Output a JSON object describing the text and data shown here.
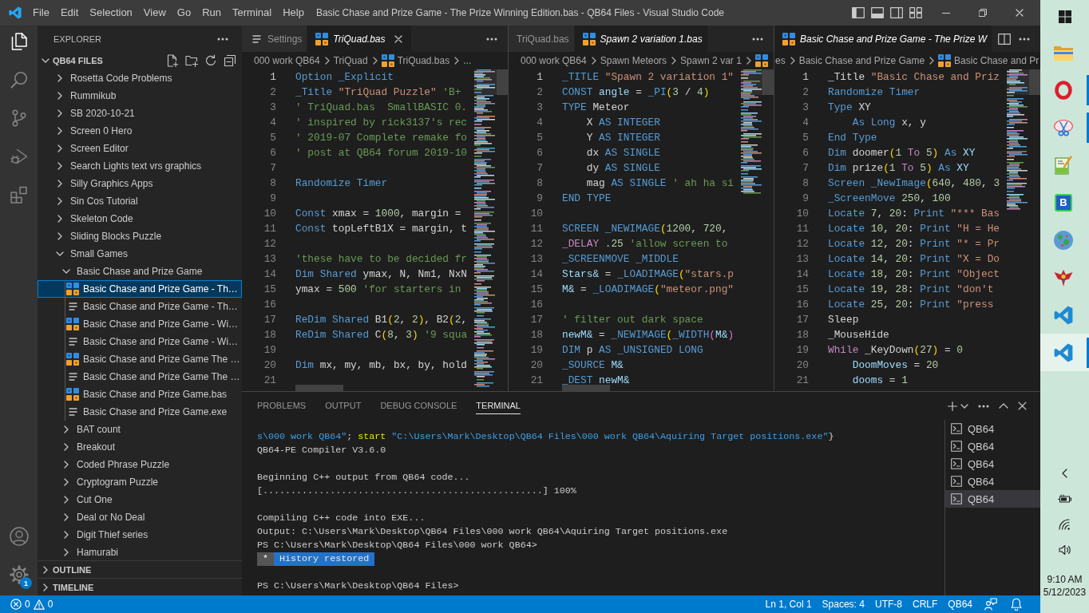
{
  "title_bar": {
    "menu": [
      "File",
      "Edit",
      "Selection",
      "View",
      "Go",
      "Run",
      "Terminal",
      "Help"
    ],
    "title": "Basic Chase and Prize Game - The Prize Winning Edition.bas - QB64 Files - Visual Studio Code"
  },
  "activity_bar": {
    "items": [
      {
        "kind": "explorer",
        "selected": true
      },
      {
        "kind": "search",
        "selected": false
      },
      {
        "kind": "source_control",
        "selected": false
      },
      {
        "kind": "run_debug",
        "selected": false
      },
      {
        "kind": "extensions",
        "selected": false
      }
    ],
    "bottom_items": [
      {
        "kind": "accounts"
      },
      {
        "kind": "manage",
        "badge": "1"
      }
    ]
  },
  "sidebar": {
    "title": "EXPLORER",
    "section": {
      "title": "QB64 FILES",
      "expanded": true
    },
    "tree": [
      {
        "label": "Rosetta Code Problems",
        "kind": "folder",
        "expanded": false,
        "selected": false
      },
      {
        "label": "Rummikub",
        "kind": "folder",
        "expanded": false,
        "selected": false
      },
      {
        "label": "SB 2020-10-21",
        "kind": "folder",
        "expanded": false,
        "selected": false
      },
      {
        "label": "Screen 0 Hero",
        "kind": "folder",
        "expanded": false,
        "selected": false
      },
      {
        "label": "Screen Editor",
        "kind": "folder",
        "expanded": false,
        "selected": false
      },
      {
        "label": "Search Lights text vrs graphics",
        "kind": "folder",
        "expanded": false,
        "selected": false
      },
      {
        "label": "Silly Graphics Apps",
        "kind": "folder",
        "expanded": false,
        "selected": false
      },
      {
        "label": "Sin Cos Tutorial",
        "kind": "folder",
        "expanded": false,
        "selected": false
      },
      {
        "label": "Skeleton Code",
        "kind": "folder",
        "expanded": false,
        "selected": false
      },
      {
        "label": "Sliding Blocks Puzzle",
        "kind": "folder",
        "expanded": false,
        "selected": false
      },
      {
        "label": "Small Games",
        "kind": "folder",
        "expanded": true,
        "selected": false,
        "children": [
          {
            "label": "Basic Chase and Prize Game",
            "kind": "folder",
            "expanded": true,
            "selected": false,
            "children": [
              {
                "label": "Basic Chase and Prize Game - Th…",
                "kind": "qb64_file",
                "selected": true
              },
              {
                "label": "Basic Chase and Prize Game - Th…",
                "kind": "plain_file",
                "selected": false
              },
              {
                "label": "Basic Chase and Prize Game - Wi…",
                "kind": "qb64_file",
                "selected": false
              },
              {
                "label": "Basic Chase and Prize Game - Wi…",
                "kind": "plain_file",
                "selected": false
              },
              {
                "label": "Basic Chase and Prize Game The …",
                "kind": "qb64_file",
                "selected": false
              },
              {
                "label": "Basic Chase and Prize Game The …",
                "kind": "plain_file",
                "selected": false
              },
              {
                "label": "Basic Chase and Prize Game.bas",
                "kind": "qb64_file",
                "selected": false
              },
              {
                "label": "Basic Chase and Prize Game.exe",
                "kind": "plain_file",
                "selected": false
              }
            ]
          },
          {
            "label": "BAT count",
            "kind": "folder",
            "expanded": false,
            "selected": false
          },
          {
            "label": "Breakout",
            "kind": "folder",
            "expanded": false,
            "selected": false
          },
          {
            "label": "Coded Phrase Puzzle",
            "kind": "folder",
            "expanded": false,
            "selected": false
          },
          {
            "label": "Cryptogram Puzzle",
            "kind": "folder",
            "expanded": false,
            "selected": false
          },
          {
            "label": "Cut One",
            "kind": "folder",
            "expanded": false,
            "selected": false
          },
          {
            "label": "Deal or No Deal",
            "kind": "folder",
            "expanded": false,
            "selected": false
          },
          {
            "label": "Digit Thief series",
            "kind": "folder",
            "expanded": false,
            "selected": false
          },
          {
            "label": "Hamurabi",
            "kind": "folder",
            "expanded": false,
            "selected": false
          }
        ]
      }
    ],
    "bottom_sections": [
      {
        "title": "OUTLINE",
        "expanded": false
      },
      {
        "title": "TIMELINE",
        "expanded": false
      }
    ]
  },
  "editor_groups": [
    {
      "tabs": [
        {
          "label": "Settings",
          "kind": "settings_file",
          "selected": false,
          "preview": false,
          "close_visible": false
        },
        {
          "label": "TriQuad.bas",
          "kind": "qb64_file",
          "selected": true,
          "preview": true,
          "close_visible": true
        }
      ],
      "split_button": false,
      "breadcrumbs": {
        "scrolled": false,
        "items": [
          {
            "label": "000 work QB64",
            "kind": "folder"
          },
          {
            "label": "TriQuad",
            "kind": "folder"
          },
          {
            "label": "TriQuad.bas",
            "kind": "file"
          },
          {
            "label": "...",
            "kind": "symbols"
          }
        ]
      },
      "horizontal_scrollbar": true,
      "lines": [
        {
          "number": "1",
          "current": true,
          "tokens": [
            {
              "kind": "keyword",
              "text": "Option _Explicit"
            }
          ]
        },
        {
          "number": "2",
          "current": false,
          "tokens": [
            {
              "kind": "keyword",
              "text": "_Title"
            },
            {
              "kind": "string",
              "text": " \"TriQuad Puzzle\""
            },
            {
              "kind": "comment",
              "text": " 'B+"
            }
          ]
        },
        {
          "number": "3",
          "current": false,
          "tokens": [
            {
              "kind": "comment",
              "text": "' TriQuad.bas  SmallBASIC 0."
            }
          ]
        },
        {
          "number": "4",
          "current": false,
          "tokens": [
            {
              "kind": "comment",
              "text": "' inspired by rick3137's rec"
            }
          ]
        },
        {
          "number": "5",
          "current": false,
          "tokens": [
            {
              "kind": "comment",
              "text": "' 2019-07 Complete remake fo"
            }
          ]
        },
        {
          "number": "6",
          "current": false,
          "tokens": [
            {
              "kind": "comment",
              "text": "' post at QB64 forum 2019-10"
            }
          ]
        },
        {
          "number": "7",
          "current": false
        },
        {
          "number": "8",
          "current": false,
          "tokens": [
            {
              "kind": "keyword",
              "text": "Randomize Timer"
            }
          ]
        },
        {
          "number": "9",
          "current": false
        },
        {
          "number": "10",
          "current": false,
          "tokens": [
            {
              "kind": "keyword",
              "text": "Const"
            },
            {
              "kind": "plain",
              "text": " xmax = "
            },
            {
              "kind": "number",
              "text": "1000"
            },
            {
              "kind": "plain",
              "text": ", margin ="
            }
          ]
        },
        {
          "number": "11",
          "current": false,
          "tokens": [
            {
              "kind": "keyword",
              "text": "Const"
            },
            {
              "kind": "plain",
              "text": " topLeftB1X = margin, t"
            }
          ]
        },
        {
          "number": "12",
          "current": false
        },
        {
          "number": "13",
          "current": false,
          "tokens": [
            {
              "kind": "comment",
              "text": "'these have to be decided fr"
            }
          ]
        },
        {
          "number": "14",
          "current": false,
          "tokens": [
            {
              "kind": "keyword",
              "text": "Dim Shared"
            },
            {
              "kind": "plain",
              "text": " ymax, N, Nm1, NxN"
            }
          ]
        },
        {
          "number": "15",
          "current": false,
          "tokens": [
            {
              "kind": "plain",
              "text": "ymax = "
            },
            {
              "kind": "number",
              "text": "500"
            },
            {
              "kind": "comment",
              "text": " 'for starters in"
            }
          ]
        },
        {
          "number": "16",
          "current": false
        },
        {
          "number": "17",
          "current": false,
          "tokens": [
            {
              "kind": "keyword",
              "text": "ReDim Shared"
            },
            {
              "kind": "plain",
              "text": " B1"
            },
            {
              "kind": "bracket",
              "text": "("
            },
            {
              "kind": "number",
              "text": "2"
            },
            {
              "kind": "plain",
              "text": ", "
            },
            {
              "kind": "number",
              "text": "2"
            },
            {
              "kind": "bracket",
              "text": ")"
            },
            {
              "kind": "plain",
              "text": ", B2"
            },
            {
              "kind": "bracket",
              "text": "("
            },
            {
              "kind": "number",
              "text": "2"
            },
            {
              "kind": "plain",
              "text": ","
            }
          ]
        },
        {
          "number": "18",
          "current": false,
          "tokens": [
            {
              "kind": "keyword",
              "text": "ReDim Shared"
            },
            {
              "kind": "plain",
              "text": " C"
            },
            {
              "kind": "bracket",
              "text": "("
            },
            {
              "kind": "number",
              "text": "8"
            },
            {
              "kind": "plain",
              "text": ", "
            },
            {
              "kind": "number",
              "text": "3"
            },
            {
              "kind": "bracket",
              "text": ")"
            },
            {
              "kind": "comment",
              "text": " '9 squa"
            }
          ]
        },
        {
          "number": "19",
          "current": false
        },
        {
          "number": "20",
          "current": false,
          "tokens": [
            {
              "kind": "keyword",
              "text": "Dim"
            },
            {
              "kind": "plain",
              "text": " mx, my, mb, bx, by, hold"
            }
          ]
        },
        {
          "number": "21",
          "current": false
        }
      ]
    },
    {
      "tabs": [
        {
          "label": "TriQuad.bas",
          "kind": "text_only",
          "selected": false,
          "preview": false,
          "close_visible": false
        },
        {
          "label": "Spawn 2 variation 1.bas",
          "kind": "qb64_file",
          "selected": true,
          "preview": true,
          "close_visible": false
        }
      ],
      "split_button": false,
      "breadcrumbs": {
        "scrolled": false,
        "items": [
          {
            "label": "000 work QB64",
            "kind": "folder"
          },
          {
            "label": "Spawn Meteors",
            "kind": "folder"
          },
          {
            "label": "Spawn 2 var 1",
            "kind": "folder"
          },
          {
            "kind": "file"
          }
        ]
      },
      "horizontal_scrollbar": true,
      "lines": [
        {
          "number": "1",
          "current": true,
          "tokens": [
            {
              "kind": "keyword",
              "text": "_TITLE"
            },
            {
              "kind": "string",
              "text": " \"Spawn 2 variation 1\""
            }
          ]
        },
        {
          "number": "2",
          "current": false,
          "tokens": [
            {
              "kind": "keyword",
              "text": "CONST"
            },
            {
              "kind": "variable",
              "text": " angle"
            },
            {
              "kind": "plain",
              "text": " = "
            },
            {
              "kind": "keyword",
              "text": "_PI"
            },
            {
              "kind": "bracket",
              "text": "("
            },
            {
              "kind": "number",
              "text": "3"
            },
            {
              "kind": "plain",
              "text": " / "
            },
            {
              "kind": "number",
              "text": "4"
            },
            {
              "kind": "bracket",
              "text": ")"
            }
          ]
        },
        {
          "number": "3",
          "current": false,
          "tokens": [
            {
              "kind": "keyword",
              "text": "TYPE"
            },
            {
              "kind": "plain",
              "text": " Meteor"
            }
          ]
        },
        {
          "number": "4",
          "current": false,
          "tokens": [
            {
              "kind": "plain",
              "text": "    X "
            },
            {
              "kind": "keyword",
              "text": "AS INTEGER"
            }
          ]
        },
        {
          "number": "5",
          "current": false,
          "tokens": [
            {
              "kind": "plain",
              "text": "    Y "
            },
            {
              "kind": "keyword",
              "text": "AS INTEGER"
            }
          ]
        },
        {
          "number": "6",
          "current": false,
          "tokens": [
            {
              "kind": "plain",
              "text": "    dx "
            },
            {
              "kind": "keyword",
              "text": "AS SINGLE"
            }
          ]
        },
        {
          "number": "7",
          "current": false,
          "tokens": [
            {
              "kind": "plain",
              "text": "    dy "
            },
            {
              "kind": "keyword",
              "text": "AS SINGLE"
            }
          ]
        },
        {
          "number": "8",
          "current": false,
          "tokens": [
            {
              "kind": "plain",
              "text": "    mag "
            },
            {
              "kind": "keyword",
              "text": "AS SINGLE"
            },
            {
              "kind": "comment",
              "text": " ' ah ha si"
            }
          ]
        },
        {
          "number": "9",
          "current": false,
          "tokens": [
            {
              "kind": "keyword",
              "text": "END TYPE"
            }
          ]
        },
        {
          "number": "10",
          "current": false
        },
        {
          "number": "11",
          "current": false,
          "tokens": [
            {
              "kind": "keyword",
              "text": "SCREEN _NEWIMAGE"
            },
            {
              "kind": "bracket",
              "text": "("
            },
            {
              "kind": "number",
              "text": "1200"
            },
            {
              "kind": "plain",
              "text": ", "
            },
            {
              "kind": "number",
              "text": "720"
            },
            {
              "kind": "plain",
              "text": ","
            }
          ]
        },
        {
          "number": "12",
          "current": false,
          "tokens": [
            {
              "kind": "control",
              "text": "_DELAY"
            },
            {
              "kind": "number",
              "text": " .25"
            },
            {
              "kind": "comment",
              "text": " 'allow screen to"
            }
          ]
        },
        {
          "number": "13",
          "current": false,
          "tokens": [
            {
              "kind": "keyword",
              "text": "_SCREENMOVE _MIDDLE"
            }
          ]
        },
        {
          "number": "14",
          "current": false,
          "tokens": [
            {
              "kind": "variable",
              "text": "Stars&"
            },
            {
              "kind": "plain",
              "text": " = "
            },
            {
              "kind": "keyword",
              "text": "_LOADIMAGE"
            },
            {
              "kind": "bracket",
              "text": "("
            },
            {
              "kind": "string",
              "text": "\"stars.p"
            }
          ]
        },
        {
          "number": "15",
          "current": false,
          "tokens": [
            {
              "kind": "variable",
              "text": "M&"
            },
            {
              "kind": "plain",
              "text": " = "
            },
            {
              "kind": "keyword",
              "text": "_LOADIMAGE"
            },
            {
              "kind": "bracket",
              "text": "("
            },
            {
              "kind": "string",
              "text": "\"meteor.png\""
            }
          ]
        },
        {
          "number": "16",
          "current": false
        },
        {
          "number": "17",
          "current": false,
          "tokens": [
            {
              "kind": "comment",
              "text": "' filter out dark space"
            }
          ]
        },
        {
          "number": "18",
          "current": false,
          "tokens": [
            {
              "kind": "variable",
              "text": "newM&"
            },
            {
              "kind": "plain",
              "text": " = "
            },
            {
              "kind": "keyword",
              "text": "_NEWIMAGE"
            },
            {
              "kind": "bracket",
              "text": "("
            },
            {
              "kind": "keyword",
              "text": "_WIDTH"
            },
            {
              "kind": "bracket2",
              "text": "("
            },
            {
              "kind": "variable",
              "text": "M&"
            },
            {
              "kind": "bracket2",
              "text": ")"
            }
          ]
        },
        {
          "number": "19",
          "current": false,
          "tokens": [
            {
              "kind": "keyword",
              "text": "DIM"
            },
            {
              "kind": "plain",
              "text": " p "
            },
            {
              "kind": "keyword",
              "text": "AS _UNSIGNED LONG"
            }
          ]
        },
        {
          "number": "20",
          "current": false,
          "tokens": [
            {
              "kind": "keyword",
              "text": "_SOURCE"
            },
            {
              "kind": "variable",
              "text": " M&"
            }
          ]
        },
        {
          "number": "21",
          "current": false,
          "tokens": [
            {
              "kind": "keyword",
              "text": "_DEST"
            },
            {
              "kind": "variable",
              "text": " newM&"
            }
          ]
        }
      ]
    },
    {
      "tabs": [
        {
          "label": "Basic Chase and Prize Game - The Prize W",
          "kind": "qb64_file",
          "selected": true,
          "preview": true,
          "close_visible": false
        }
      ],
      "split_button": true,
      "breadcrumbs": {
        "scrolled": true,
        "items": [
          {
            "label": "es",
            "kind": "folder"
          },
          {
            "label": "Basic Chase and Prize Game",
            "kind": "folder"
          },
          {
            "label": "Basic Chase and Pr",
            "kind": "file"
          }
        ]
      },
      "horizontal_scrollbar": false,
      "lines": [
        {
          "number": "1",
          "current": true,
          "tokens": [
            {
              "kind": "plain",
              "text": "_Title "
            },
            {
              "kind": "string",
              "text": "\"Basic Chase and Priz"
            }
          ]
        },
        {
          "number": "2",
          "current": false,
          "tokens": [
            {
              "kind": "keyword",
              "text": "Randomize Timer"
            }
          ]
        },
        {
          "number": "3",
          "current": false,
          "tokens": [
            {
              "kind": "keyword",
              "text": "Type"
            },
            {
              "kind": "plain",
              "text": " XY"
            }
          ]
        },
        {
          "number": "4",
          "current": false,
          "tokens": [
            {
              "kind": "keyword",
              "text": "    As Long"
            },
            {
              "kind": "plain",
              "text": " x, y"
            }
          ]
        },
        {
          "number": "5",
          "current": false,
          "tokens": [
            {
              "kind": "keyword",
              "text": "End Type"
            }
          ]
        },
        {
          "number": "6",
          "current": false,
          "tokens": [
            {
              "kind": "keyword",
              "text": "Dim"
            },
            {
              "kind": "plain",
              "text": " doomer"
            },
            {
              "kind": "bracket",
              "text": "("
            },
            {
              "kind": "number",
              "text": "1"
            },
            {
              "kind": "control",
              "text": " To"
            },
            {
              "kind": "number",
              "text": " 5"
            },
            {
              "kind": "bracket",
              "text": ")"
            },
            {
              "kind": "keyword",
              "text": " As"
            },
            {
              "kind": "variable",
              "text": " XY"
            }
          ]
        },
        {
          "number": "7",
          "current": false,
          "tokens": [
            {
              "kind": "keyword",
              "text": "Dim"
            },
            {
              "kind": "plain",
              "text": " prize"
            },
            {
              "kind": "bracket",
              "text": "("
            },
            {
              "kind": "number",
              "text": "1"
            },
            {
              "kind": "control",
              "text": " To"
            },
            {
              "kind": "number",
              "text": " 5"
            },
            {
              "kind": "bracket",
              "text": ")"
            },
            {
              "kind": "keyword",
              "text": " As"
            },
            {
              "kind": "variable",
              "text": " XY"
            }
          ]
        },
        {
          "number": "8",
          "current": false,
          "tokens": [
            {
              "kind": "keyword",
              "text": "Screen _NewImage"
            },
            {
              "kind": "bracket",
              "text": "("
            },
            {
              "kind": "number",
              "text": "640"
            },
            {
              "kind": "plain",
              "text": ", "
            },
            {
              "kind": "number",
              "text": "480"
            },
            {
              "kind": "plain",
              "text": ", "
            },
            {
              "kind": "number",
              "text": "3"
            }
          ]
        },
        {
          "number": "9",
          "current": false,
          "tokens": [
            {
              "kind": "keyword",
              "text": "_ScreenMove"
            },
            {
              "kind": "number",
              "text": " 250"
            },
            {
              "kind": "plain",
              "text": ", "
            },
            {
              "kind": "number",
              "text": "100"
            }
          ]
        },
        {
          "number": "10",
          "current": false,
          "tokens": [
            {
              "kind": "keyword",
              "text": "Locate"
            },
            {
              "kind": "number",
              "text": " 7"
            },
            {
              "kind": "plain",
              "text": ", "
            },
            {
              "kind": "number",
              "text": "20"
            },
            {
              "kind": "plain",
              "text": ": "
            },
            {
              "kind": "keyword",
              "text": "Print"
            },
            {
              "kind": "string",
              "text": " \"*** Bas"
            }
          ]
        },
        {
          "number": "11",
          "current": false,
          "tokens": [
            {
              "kind": "keyword",
              "text": "Locate"
            },
            {
              "kind": "number",
              "text": " 10"
            },
            {
              "kind": "plain",
              "text": ", "
            },
            {
              "kind": "number",
              "text": "20"
            },
            {
              "kind": "plain",
              "text": ": "
            },
            {
              "kind": "keyword",
              "text": "Print"
            },
            {
              "kind": "string",
              "text": " \"H = He"
            }
          ]
        },
        {
          "number": "12",
          "current": false,
          "tokens": [
            {
              "kind": "keyword",
              "text": "Locate"
            },
            {
              "kind": "number",
              "text": " 12"
            },
            {
              "kind": "plain",
              "text": ", "
            },
            {
              "kind": "number",
              "text": "20"
            },
            {
              "kind": "plain",
              "text": ": "
            },
            {
              "kind": "keyword",
              "text": "Print"
            },
            {
              "kind": "string",
              "text": " \"* = Pr"
            }
          ]
        },
        {
          "number": "13",
          "current": false,
          "tokens": [
            {
              "kind": "keyword",
              "text": "Locate"
            },
            {
              "kind": "number",
              "text": " 14"
            },
            {
              "kind": "plain",
              "text": ", "
            },
            {
              "kind": "number",
              "text": "20"
            },
            {
              "kind": "plain",
              "text": ": "
            },
            {
              "kind": "keyword",
              "text": "Print"
            },
            {
              "kind": "string",
              "text": " \"X = Do"
            }
          ]
        },
        {
          "number": "14",
          "current": false,
          "tokens": [
            {
              "kind": "keyword",
              "text": "Locate"
            },
            {
              "kind": "number",
              "text": " 18"
            },
            {
              "kind": "plain",
              "text": ", "
            },
            {
              "kind": "number",
              "text": "20"
            },
            {
              "kind": "plain",
              "text": ": "
            },
            {
              "kind": "keyword",
              "text": "Print"
            },
            {
              "kind": "string",
              "text": " \"Object"
            }
          ]
        },
        {
          "number": "15",
          "current": false,
          "tokens": [
            {
              "kind": "keyword",
              "text": "Locate"
            },
            {
              "kind": "number",
              "text": " 19"
            },
            {
              "kind": "plain",
              "text": ", "
            },
            {
              "kind": "number",
              "text": "28"
            },
            {
              "kind": "plain",
              "text": ": "
            },
            {
              "kind": "keyword",
              "text": "Print"
            },
            {
              "kind": "string",
              "text": " \"don't"
            }
          ]
        },
        {
          "number": "16",
          "current": false,
          "tokens": [
            {
              "kind": "keyword",
              "text": "Locate"
            },
            {
              "kind": "number",
              "text": " 25"
            },
            {
              "kind": "plain",
              "text": ", "
            },
            {
              "kind": "number",
              "text": "20"
            },
            {
              "kind": "plain",
              "text": ": "
            },
            {
              "kind": "keyword",
              "text": "Print"
            },
            {
              "kind": "string",
              "text": " \"press"
            }
          ]
        },
        {
          "number": "17",
          "current": false,
          "tokens": [
            {
              "kind": "plain",
              "text": "Sleep"
            }
          ]
        },
        {
          "number": "18",
          "current": false,
          "tokens": [
            {
              "kind": "plain",
              "text": "_MouseHide"
            }
          ]
        },
        {
          "number": "19",
          "current": false,
          "tokens": [
            {
              "kind": "control",
              "text": "While"
            },
            {
              "kind": "plain",
              "text": " _KeyDown"
            },
            {
              "kind": "bracket",
              "text": "("
            },
            {
              "kind": "number",
              "text": "27"
            },
            {
              "kind": "bracket",
              "text": ")"
            },
            {
              "kind": "plain",
              "text": " = "
            },
            {
              "kind": "number",
              "text": "0"
            }
          ]
        },
        {
          "number": "20",
          "current": false,
          "tokens": [
            {
              "kind": "variable",
              "text": "    DoomMoves"
            },
            {
              "kind": "plain",
              "text": " = "
            },
            {
              "kind": "number",
              "text": "20"
            }
          ]
        },
        {
          "number": "21",
          "current": false,
          "tokens": [
            {
              "kind": "variable",
              "text": "    dooms"
            },
            {
              "kind": "plain",
              "text": " = "
            },
            {
              "kind": "number",
              "text": "1"
            }
          ]
        }
      ]
    }
  ],
  "panel": {
    "tabs": [
      {
        "label": "PROBLEMS",
        "selected": false
      },
      {
        "label": "OUTPUT",
        "selected": false
      },
      {
        "label": "DEBUG CONSOLE",
        "selected": false
      },
      {
        "label": "TERMINAL",
        "selected": true
      }
    ],
    "terminal_lines": [
      {
        "kind": "colored",
        "tokens": [
          {
            "kind": "string",
            "text": "s\\000 work QB64\""
          },
          {
            "kind": "plain",
            "text": "; "
          },
          {
            "kind": "command",
            "text": "start"
          },
          {
            "kind": "string",
            "text": " \"C:\\Users\\Mark\\Desktop\\QB64 Files\\000 work QB64\\Aquiring Target positions.exe\""
          },
          {
            "kind": "plain",
            "text": "}"
          }
        ]
      },
      {
        "kind": "text",
        "text": "QB64-PE Compiler V3.6.0"
      },
      {
        "kind": "blank"
      },
      {
        "kind": "text",
        "text": "Beginning C++ output from QB64 code..."
      },
      {
        "kind": "text",
        "text": "[..................................................] 100%"
      },
      {
        "kind": "blank"
      },
      {
        "kind": "text",
        "text": "Compiling C++ code into EXE..."
      },
      {
        "kind": "text",
        "text": "Output: C:\\Users\\Mark\\Desktop\\QB64 Files\\000 work QB64\\Aquiring Target positions.exe"
      },
      {
        "kind": "text",
        "text": "PS C:\\Users\\Mark\\Desktop\\QB64 Files\\000 work QB64>"
      },
      {
        "kind": "badge",
        "marker": "*",
        "text": "History restored"
      },
      {
        "kind": "blank"
      },
      {
        "kind": "text",
        "text": "PS C:\\Users\\Mark\\Desktop\\QB64 Files>"
      }
    ],
    "terminals": [
      {
        "label": "QB64",
        "selected": false
      },
      {
        "label": "QB64",
        "selected": false
      },
      {
        "label": "QB64",
        "selected": false
      },
      {
        "label": "QB64",
        "selected": false
      },
      {
        "label": "QB64",
        "selected": true
      }
    ]
  },
  "status_bar": {
    "errors": "0",
    "warnings": "0",
    "items": [
      "Ln 1, Col 1",
      "Spaces: 4",
      "UTF-8",
      "CRLF",
      "QB64"
    ]
  },
  "taskbar": {
    "apps": [
      {
        "kind": "folder",
        "running": false,
        "active": false
      },
      {
        "kind": "browser",
        "running": true,
        "active": false
      },
      {
        "kind": "snipping",
        "running": true,
        "active": false
      },
      {
        "kind": "notepad",
        "running": false,
        "active": false
      },
      {
        "kind": "letter_tile",
        "letter": "B",
        "running": false,
        "active": false
      },
      {
        "kind": "globe",
        "running": false,
        "active": false
      },
      {
        "kind": "emblem",
        "running": false,
        "active": false
      },
      {
        "kind": "code_editor",
        "running": false,
        "active": false
      },
      {
        "kind": "code_editor",
        "running": true,
        "active": true
      }
    ],
    "time": "9:10 AM",
    "date": "5/12/2023"
  }
}
